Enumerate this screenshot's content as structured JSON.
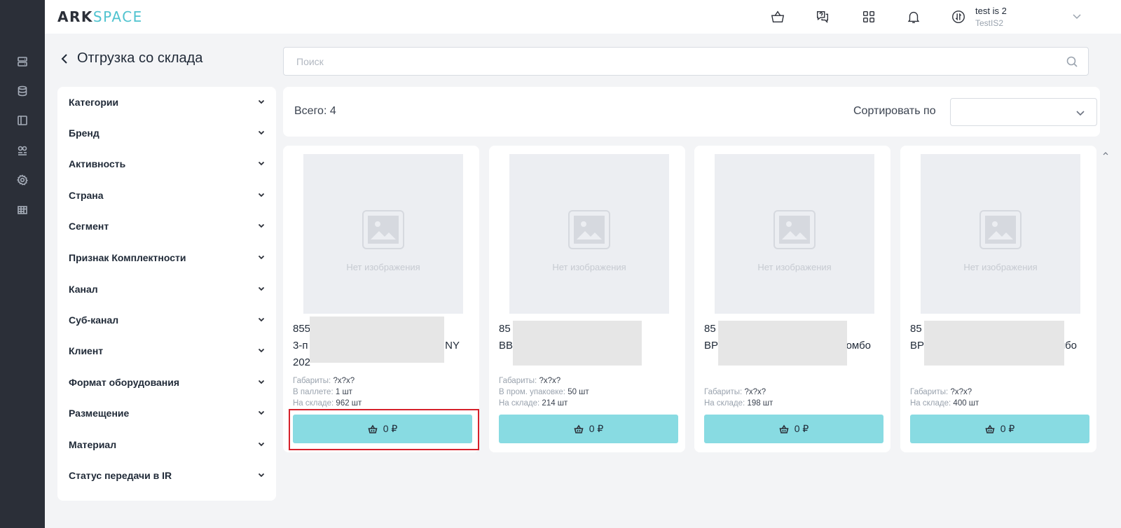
{
  "header": {
    "logo_part1": "ARK",
    "logo_part2": "SPACE",
    "user_name": "test is 2",
    "user_org": "TestIS2",
    "icons": [
      "basket-icon",
      "support-chat-icon",
      "apps-grid-icon",
      "bell-icon",
      "exchange-icon"
    ]
  },
  "rail": {
    "icons": [
      "orders-icon",
      "database-icon",
      "layout-icon",
      "users-icon",
      "settings-icon",
      "table-icon"
    ]
  },
  "page": {
    "title": "Отгрузка со склада"
  },
  "search": {
    "placeholder": "Поиск",
    "value": ""
  },
  "filters": [
    "Категории",
    "Бренд",
    "Активность",
    "Страна",
    "Сегмент",
    "Признак Комплектности",
    "Канал",
    "Суб-канал",
    "Клиент",
    "Формат оборудования",
    "Размещение",
    "Материал",
    "Статус передачи в IR"
  ],
  "toolbar": {
    "total": "Всего: 4",
    "sort_label": "Сортировать по",
    "sort_value": ""
  },
  "products": [
    {
      "title_visible": "855\n3-п                                    , NY\n202",
      "line1": "855",
      "line2a": "3-п",
      "line2b": ", NY",
      "line3": "202",
      "no_image": "Нет изображения",
      "meta": [
        {
          "label": "Габариты:",
          "value": "?x?x?"
        },
        {
          "label": "В паллете:",
          "value": "1 шт"
        },
        {
          "label": "На складе:",
          "value": "962 шт"
        }
      ],
      "price": "0 ₽"
    },
    {
      "line1": "85",
      "line2a": "BB",
      "line2b": "",
      "line3": "",
      "no_image": "Нет изображения",
      "meta": [
        {
          "label": "Габариты:",
          "value": "?x?x?"
        },
        {
          "label": "В пром. упаковке:",
          "value": "50 шт"
        },
        {
          "label": "На складе:",
          "value": "214 шт"
        }
      ],
      "price": "0 ₽"
    },
    {
      "line1": "85",
      "line2a": "BP",
      "line2b": "омбо",
      "line3": "",
      "no_image": "Нет изображения",
      "meta": [
        {
          "label": "Габариты:",
          "value": "?x?x?"
        },
        {
          "label": "На складе:",
          "value": "198 шт"
        }
      ],
      "price": "0 ₽"
    },
    {
      "line1": "85",
      "line2a": "BP",
      "line2b": "омбо",
      "line3": "",
      "no_image": "Нет изображения",
      "meta": [
        {
          "label": "Габариты:",
          "value": "?x?x?"
        },
        {
          "label": "На складе:",
          "value": "400 шт"
        }
      ],
      "price": "0 ₽"
    }
  ],
  "colors": {
    "rail_bg": "#2b2f38",
    "accent": "#4fc3cf",
    "button_bg": "#88dbe2",
    "highlight": "#d6212b"
  }
}
